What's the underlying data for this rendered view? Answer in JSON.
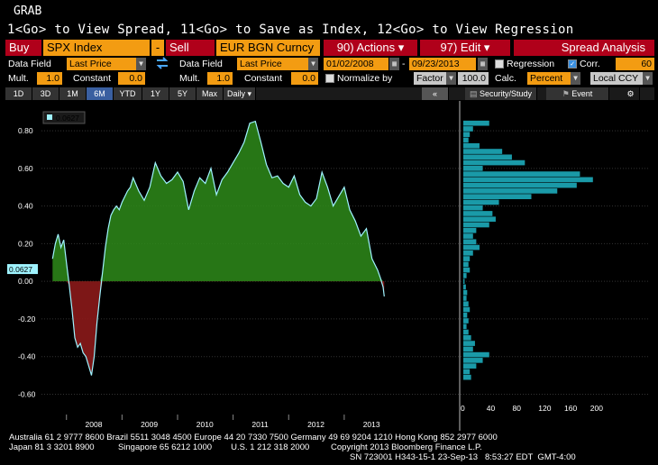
{
  "header": {
    "title": "GRAB",
    "instructions": "1<Go> to View Spread, 11<Go> to Save as Index, 12<Go> to View Regression"
  },
  "toolbar": {
    "buy_label": "Buy",
    "buy_security": "SPX Index",
    "minus_label": "-",
    "sell_label": "Sell",
    "sell_security": "EUR BGN Curncy",
    "actions_label": "90) Actions ▾",
    "edit_label": "97) Edit ▾",
    "spread_analysis_label": "Spread Analysis"
  },
  "params": {
    "data_field_label": "Data Field",
    "data_field_1": "Last Price",
    "data_field_2": "Last Price",
    "mult_label": "Mult.",
    "mult_1": "1.0",
    "constant_label": "Constant",
    "constant_1": "0.0",
    "mult_2": "1.0",
    "constant_2": "0.0",
    "start_date": "01/02/2008",
    "end_date": "09/23/2013",
    "regression_label": "Regression",
    "corr_label": "Corr.",
    "corr_window": "60",
    "normalize_label": "Normalize by",
    "factor_label": "Factor",
    "factor_value": "100.0",
    "calc_label": "Calc.",
    "calc_value": "Percent",
    "currency_value": "Local CCY"
  },
  "tabs": [
    "1D",
    "3D",
    "1M",
    "6M",
    "YTD",
    "1Y",
    "5Y",
    "Max",
    "Daily ▾"
  ],
  "right_tabs": {
    "collapse": "«",
    "security_study": "Security/Study",
    "event": "Event"
  },
  "chart_data": {
    "type": "area",
    "legend_value": "0.0627",
    "last_value_label": "0.0627",
    "y_ticks": [
      "0.80",
      "0.60",
      "0.40",
      "0.20",
      "0.00",
      "-0.20",
      "-0.40",
      "-0.60"
    ],
    "y_tick_values": [
      0.8,
      0.6,
      0.4,
      0.2,
      0.0,
      -0.2,
      -0.4,
      -0.6
    ],
    "ylim": [
      -0.66,
      0.92
    ],
    "x_ticks": [
      "2008",
      "2009",
      "2010",
      "2011",
      "2012",
      "2013"
    ],
    "x_tick_values": [
      2008.0,
      2009.0,
      2010.0,
      2011.0,
      2012.0,
      2013.0
    ],
    "xlim": [
      2007.55,
      2014.3
    ],
    "series": [
      {
        "x": [
          2007.75,
          2007.8,
          2007.85,
          2007.9,
          2007.95,
          2008.0,
          2008.05,
          2008.1,
          2008.15,
          2008.2,
          2008.25,
          2008.3,
          2008.35,
          2008.4,
          2008.45,
          2008.5,
          2008.55,
          2008.6,
          2008.65,
          2008.7,
          2008.75,
          2008.8,
          2008.85,
          2008.9,
          2008.95,
          2009.0,
          2009.05,
          2009.1,
          2009.15,
          2009.2,
          2009.3,
          2009.4,
          2009.5,
          2009.6,
          2009.7,
          2009.8,
          2009.9,
          2010.0,
          2010.1,
          2010.2,
          2010.3,
          2010.4,
          2010.5,
          2010.6,
          2010.7,
          2010.8,
          2010.9,
          2011.0,
          2011.1,
          2011.2,
          2011.3,
          2011.4,
          2011.5,
          2011.6,
          2011.7,
          2011.8,
          2011.9,
          2012.0,
          2012.1,
          2012.2,
          2012.3,
          2012.4,
          2012.5,
          2012.6,
          2012.7,
          2012.8,
          2012.9,
          2013.0,
          2013.1,
          2013.2,
          2013.3,
          2013.4,
          2013.5,
          2013.6,
          2013.65,
          2013.7,
          2013.72
        ],
        "values": [
          0.12,
          0.2,
          0.25,
          0.18,
          0.22,
          0.1,
          -0.02,
          -0.15,
          -0.3,
          -0.35,
          -0.33,
          -0.38,
          -0.4,
          -0.45,
          -0.5,
          -0.4,
          -0.22,
          -0.08,
          0.05,
          0.18,
          0.28,
          0.35,
          0.38,
          0.4,
          0.38,
          0.42,
          0.45,
          0.48,
          0.5,
          0.55,
          0.48,
          0.43,
          0.5,
          0.63,
          0.56,
          0.52,
          0.54,
          0.58,
          0.53,
          0.38,
          0.48,
          0.55,
          0.52,
          0.6,
          0.46,
          0.54,
          0.58,
          0.63,
          0.68,
          0.74,
          0.84,
          0.85,
          0.74,
          0.62,
          0.55,
          0.56,
          0.52,
          0.5,
          0.56,
          0.46,
          0.42,
          0.4,
          0.44,
          0.58,
          0.5,
          0.4,
          0.45,
          0.5,
          0.38,
          0.32,
          0.24,
          0.28,
          0.12,
          0.06,
          0.02,
          -0.03,
          -0.08
        ]
      }
    ],
    "histogram": {
      "x_ticks": [
        "0",
        "40",
        "80",
        "120",
        "160",
        "200"
      ],
      "x_tick_values": [
        0,
        40,
        80,
        120,
        160,
        200
      ],
      "xlim": [
        0,
        210
      ],
      "bin_centers": [
        0.84,
        0.81,
        0.78,
        0.75,
        0.72,
        0.69,
        0.66,
        0.63,
        0.6,
        0.57,
        0.54,
        0.51,
        0.48,
        0.45,
        0.42,
        0.39,
        0.36,
        0.33,
        0.3,
        0.27,
        0.24,
        0.21,
        0.18,
        0.15,
        0.12,
        0.09,
        0.06,
        0.03,
        0.0,
        -0.03,
        -0.06,
        -0.09,
        -0.12,
        -0.15,
        -0.18,
        -0.21,
        -0.24,
        -0.27,
        -0.3,
        -0.33,
        -0.36,
        -0.39,
        -0.42,
        -0.45,
        -0.48,
        -0.51
      ],
      "counts": [
        40,
        15,
        10,
        8,
        25,
        60,
        75,
        95,
        30,
        180,
        200,
        175,
        145,
        105,
        55,
        30,
        45,
        50,
        40,
        20,
        15,
        20,
        25,
        15,
        10,
        8,
        10,
        5,
        2,
        4,
        6,
        5,
        8,
        10,
        6,
        8,
        5,
        8,
        12,
        18,
        15,
        40,
        30,
        20,
        10,
        12
      ]
    }
  },
  "footer": {
    "line1": "Australia 61 2 9777 8600 Brazil 5511 3048 4500 Europe 44 20 7330 7500 Germany 49 69 9204 1210 Hong Kong 852 2977 6000",
    "line2": "Japan 81 3 3201 8900          Singapore 65 6212 1000        U.S. 1 212 318 2000         Copyright 2013 Bloomberg Finance L.P.",
    "line3": "SN 723001 H343-15-1 23-Sep-13   8:53:27 EDT  GMT-4:00"
  },
  "colors": {
    "accent_red": "#b0001a",
    "accent_orange": "#f39c12",
    "series_line": "#9ff3ff",
    "area_positive": "#2e8b1a",
    "area_negative": "#8b1a1a",
    "histogram_bar": "#1a9aa8"
  }
}
